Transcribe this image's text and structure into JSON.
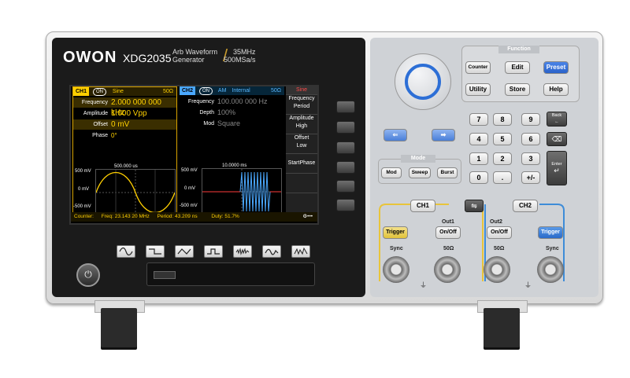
{
  "brand": {
    "logo": "OWON",
    "model": "XDG2035",
    "desc_line1": "Arb Waveform",
    "desc_line2": "Generator",
    "spec_line1": "35MHz",
    "spec_line2": "500MSa/s"
  },
  "ch1": {
    "tag": "CH1",
    "on": "ON",
    "wave": "Sine",
    "impedance": "50Ω",
    "rows": [
      {
        "label": "Frequency",
        "value": "2.000 000 000 kHz"
      },
      {
        "label": "Amplitude",
        "value": "1.000 Vpp"
      },
      {
        "label": "Offset",
        "value": "0 mV"
      },
      {
        "label": "Phase",
        "value": "0°"
      }
    ],
    "time_label": "500.000 us",
    "y_top": "500 mV",
    "y_mid": "0 mV",
    "y_bot": "-500 mV"
  },
  "ch2": {
    "tag": "CH2",
    "on": "ON",
    "mode": "AM",
    "source": "Internal",
    "impedance": "50Ω",
    "rows": [
      {
        "label": "Frequency",
        "value": "100.000 000 Hz"
      },
      {
        "label": "Depth",
        "value": "100%"
      },
      {
        "label": "Mod",
        "value": "Square"
      }
    ],
    "time_label": "10.0000 ms",
    "y_top": "500 mV",
    "y_mid": "0 mV",
    "y_bot": "-500 mV"
  },
  "softkeys": {
    "title": "Sine",
    "k1a": "Frequency",
    "k1b": "Period",
    "k2a": "Amplitude",
    "k2b": "High",
    "k3a": "Offset",
    "k3b": "Low",
    "k4": "StartPhase"
  },
  "status": {
    "counter": "Counter:",
    "freq": "Freq: 23.143 20 MHz",
    "period": "Period: 43.209 ns",
    "duty": "Duty: 51.7%"
  },
  "panel": {
    "function_label": "Function",
    "counter": "Counter",
    "edit": "Edit",
    "preset": "Preset",
    "utility": "Utility",
    "store": "Store",
    "help": "Help",
    "keys": [
      "7",
      "8",
      "9",
      "4",
      "5",
      "6",
      "1",
      "2",
      "3",
      "0",
      ".",
      "+/-"
    ],
    "back": "Back",
    "enter": "Enter",
    "mode_label": "Mode",
    "mod": "Mod",
    "sweep": "Sweep",
    "burst": "Burst",
    "ch1": "CH1",
    "ch2": "CH2",
    "out1": "Out1",
    "out2": "Out2",
    "onoff1": "On/Off",
    "onoff2": "On/Off",
    "trigger1": "Trigger",
    "trigger2": "Trigger",
    "sync1": "Sync",
    "sync2": "Sync",
    "imp1": "50Ω",
    "imp2": "50Ω"
  },
  "colors": {
    "ch1": "#ffcf00",
    "ch2": "#4aa8ff",
    "preset": "#2a62c9",
    "trigger_ch1": "#e9c93b"
  }
}
